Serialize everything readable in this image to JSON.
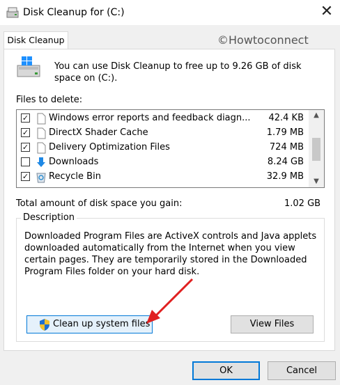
{
  "window": {
    "title": "Disk Cleanup for  (C:)",
    "close_glyph": "✕"
  },
  "tab": {
    "label": "Disk Cleanup"
  },
  "watermark": "©Howtoconnect",
  "intro": "You can use Disk Cleanup to free up to 9.26 GB of disk space on (C:).",
  "files_label": "Files to delete:",
  "files": [
    {
      "name": "Windows error reports and feedback diagn...",
      "size": "42.4 KB",
      "checked": true,
      "icon": "file-icon"
    },
    {
      "name": "DirectX Shader Cache",
      "size": "1.79 MB",
      "checked": true,
      "icon": "file-icon"
    },
    {
      "name": "Delivery Optimization Files",
      "size": "724 MB",
      "checked": true,
      "icon": "file-icon"
    },
    {
      "name": "Downloads",
      "size": "8.24 GB",
      "checked": false,
      "icon": "download-arrow-icon"
    },
    {
      "name": "Recycle Bin",
      "size": "32.9 MB",
      "checked": true,
      "icon": "recycle-bin-icon"
    }
  ],
  "check_glyph": "✓",
  "scrollbar": {
    "up_glyph": "▲",
    "down_glyph": "▼"
  },
  "total": {
    "label": "Total amount of disk space you gain:",
    "value": "1.02 GB"
  },
  "description": {
    "legend": "Description",
    "text": "Downloaded Program Files are ActiveX controls and Java applets downloaded automatically from the Internet when you view certain pages. They are temporarily stored in the Downloaded Program Files folder on your hard disk."
  },
  "buttons": {
    "cleanup": "Clean up system files",
    "view_files": "View Files",
    "ok": "OK",
    "cancel": "Cancel"
  },
  "colors": {
    "accent": "#0078d7",
    "annotation_arrow": "#e02020"
  }
}
